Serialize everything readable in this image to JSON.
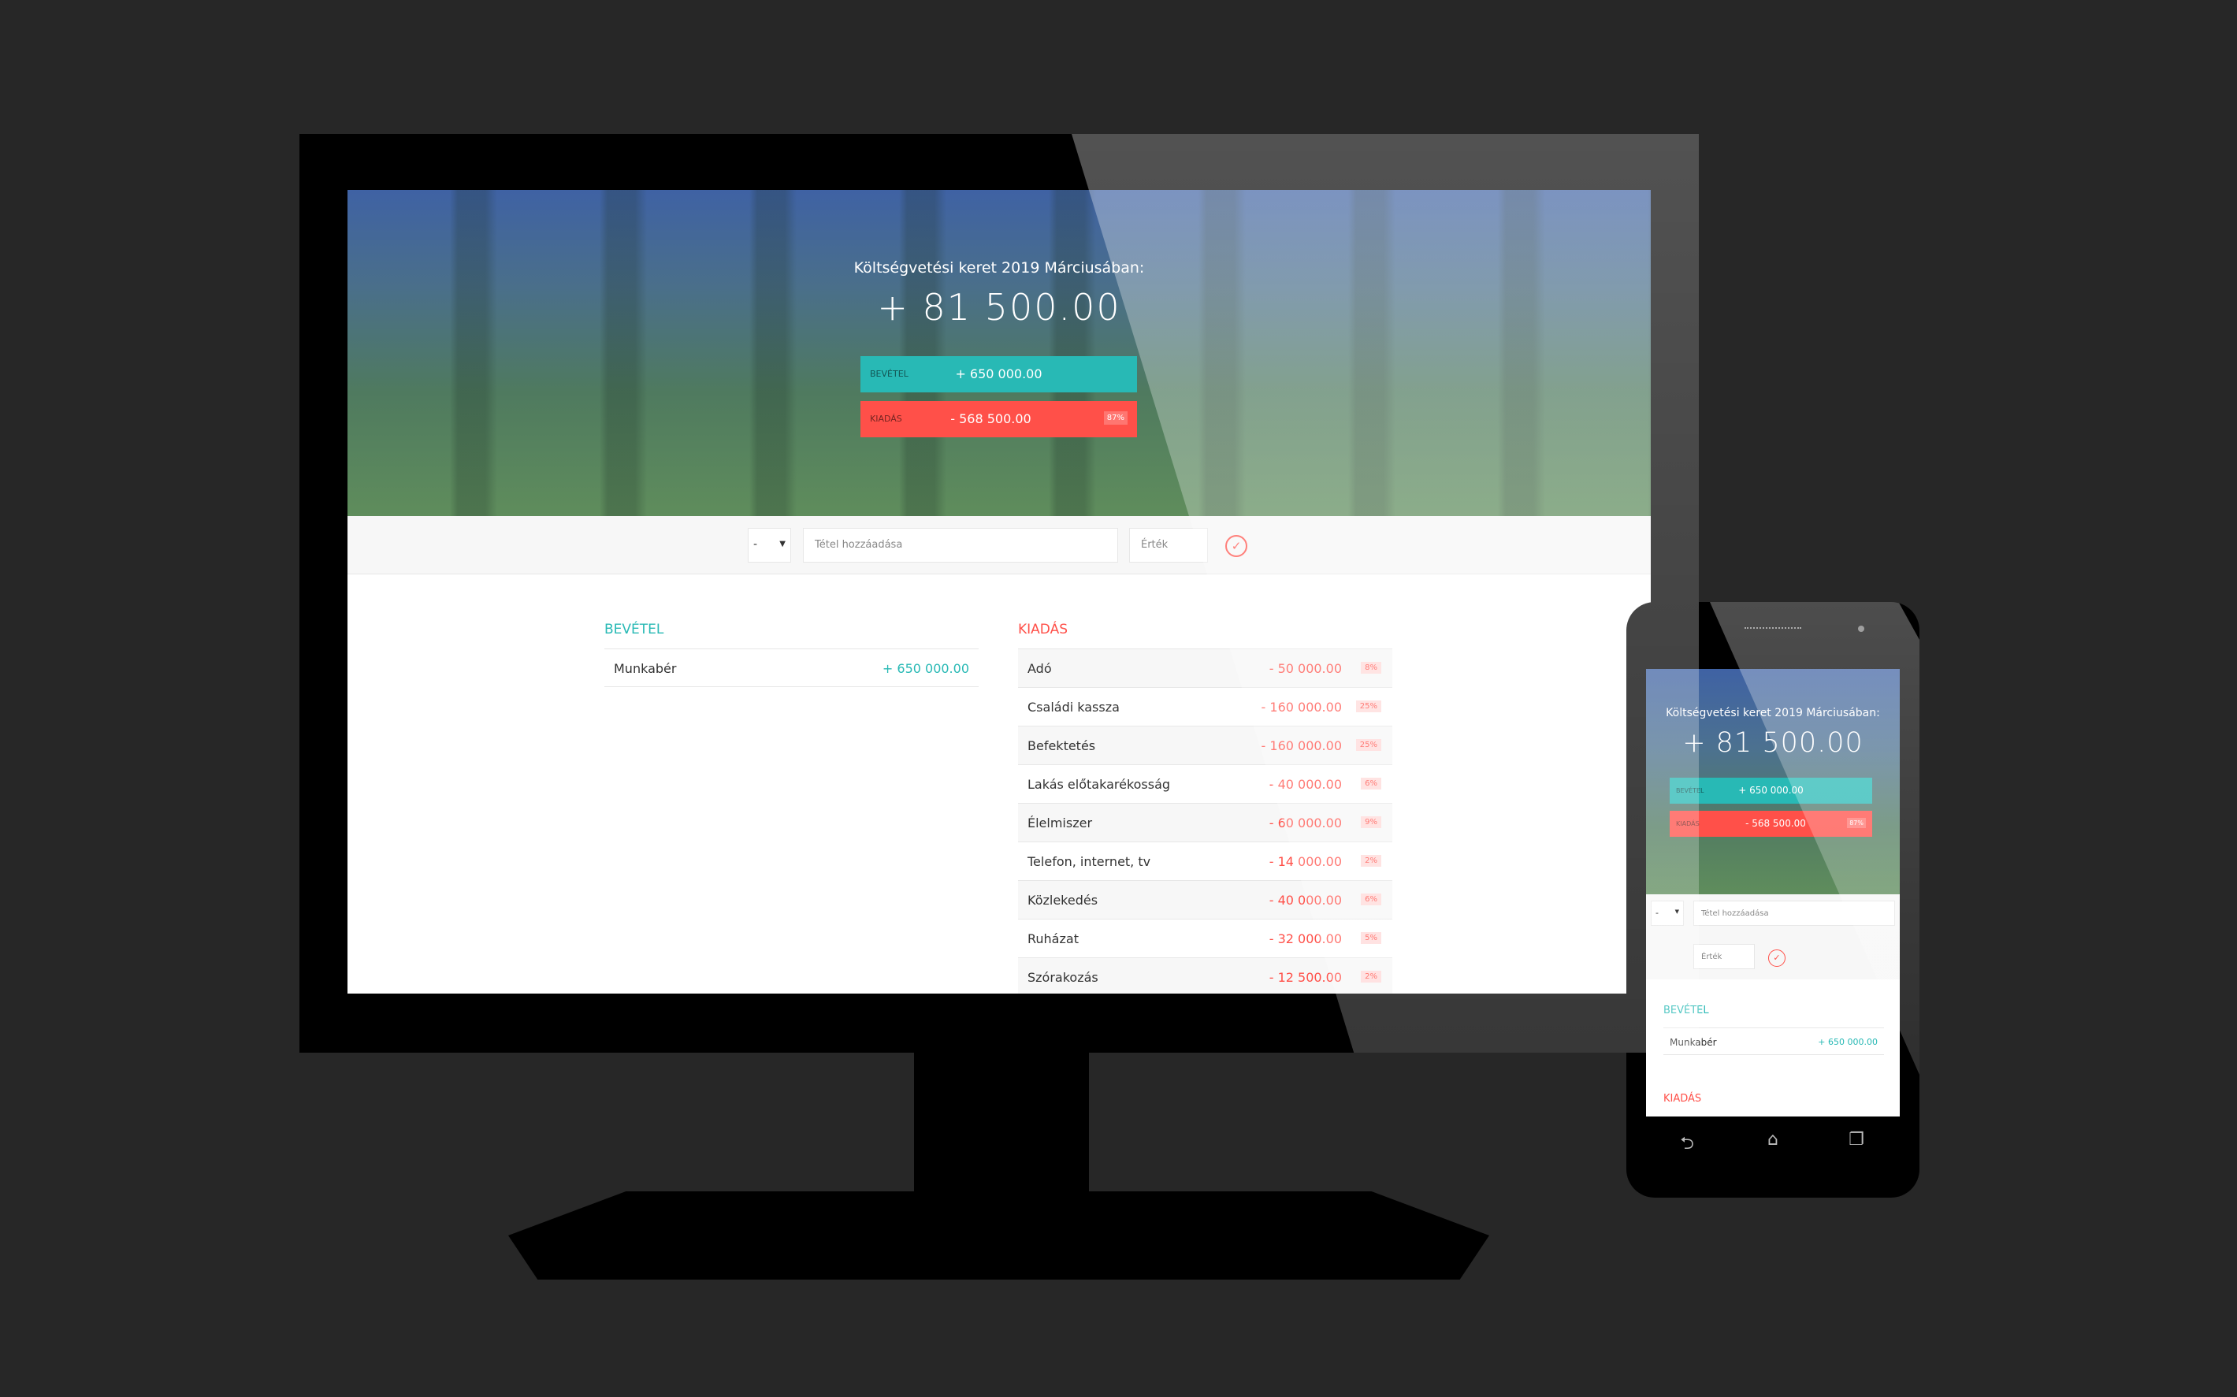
{
  "desktop": {
    "hero": {
      "title": "Költségvetési keret 2019 Márciusában:",
      "total": "+ 81 500.00",
      "income_label": "Bevétel",
      "income_value": "+ 650 000.00",
      "expense_label": "Kiadás",
      "expense_value": "- 568 500.00",
      "expense_percent": "87%"
    },
    "add": {
      "type_value": "-",
      "description_placeholder": "Tétel hozzáadása",
      "value_placeholder": "Érték"
    },
    "income": {
      "title": "Bevétel",
      "items": [
        {
          "desc": "Munkabér",
          "value": "+ 650 000.00"
        }
      ]
    },
    "expenses": {
      "title": "Kiadás",
      "items": [
        {
          "desc": "Adó",
          "value": "- 50 000.00",
          "pct": "8%"
        },
        {
          "desc": "Családi kassza",
          "value": "- 160 000.00",
          "pct": "25%"
        },
        {
          "desc": "Befektetés",
          "value": "- 160 000.00",
          "pct": "25%"
        },
        {
          "desc": "Lakás előtakarékosság",
          "value": "- 40 000.00",
          "pct": "6%"
        },
        {
          "desc": "Élelmiszer",
          "value": "- 60 000.00",
          "pct": "9%"
        },
        {
          "desc": "Telefon, internet, tv",
          "value": "- 14 000.00",
          "pct": "2%"
        },
        {
          "desc": "Közlekedés",
          "value": "- 40 000.00",
          "pct": "6%"
        },
        {
          "desc": "Ruházat",
          "value": "- 32 000.00",
          "pct": "5%"
        },
        {
          "desc": "Szórakozás",
          "value": "- 12 500.00",
          "pct": "2%"
        }
      ]
    }
  },
  "mobile": {
    "hero": {
      "title": "Költségvetési keret 2019 Márciusában:",
      "total": "+ 81 500.00",
      "income_label": "Bevétel",
      "income_value": "+ 650 000.00",
      "expense_label": "Kiadás",
      "expense_value": "- 568 500.00",
      "expense_percent": "87%"
    },
    "add": {
      "type_value": "-",
      "description_placeholder": "Tétel hozzáadása",
      "value_placeholder": "Érték"
    },
    "income_title": "Bevétel",
    "income_item": {
      "desc": "Munkabér",
      "value": "+ 650 000.00"
    },
    "expense_title": "Kiadás",
    "nav_icons": [
      "back-icon",
      "home-icon",
      "recent-apps-icon"
    ]
  },
  "colors": {
    "income": "#28b9b5",
    "expense": "#ff5049",
    "background": "#272727"
  }
}
